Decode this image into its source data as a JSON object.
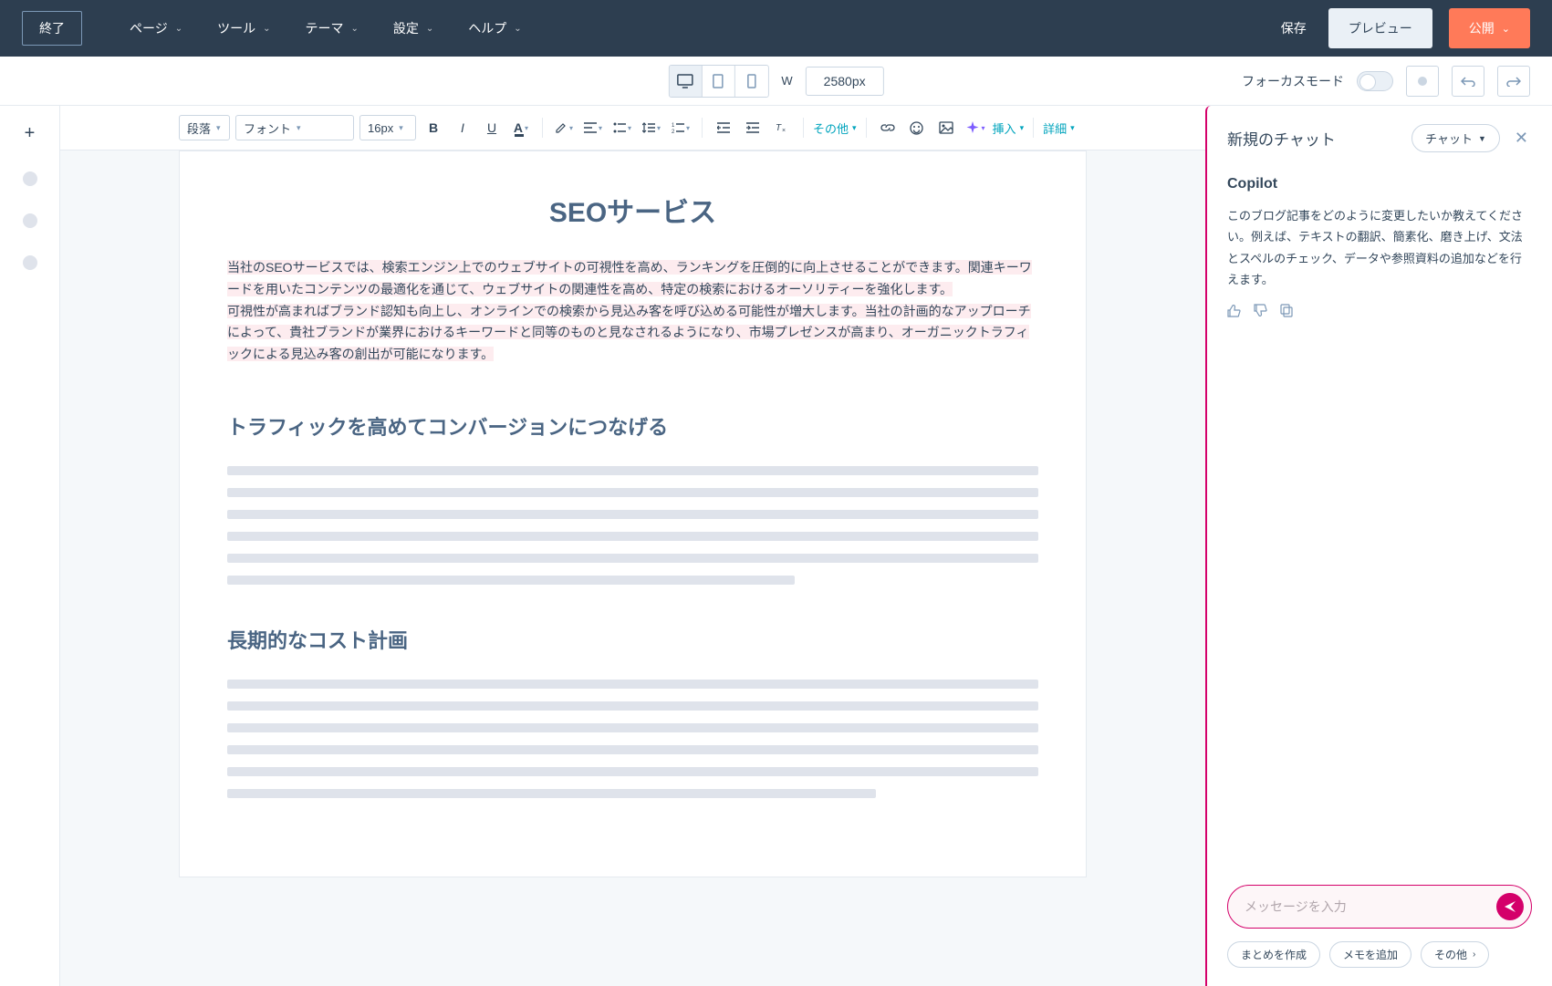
{
  "topbar": {
    "exit": "終了",
    "menus": [
      "ページ",
      "ツール",
      "テーマ",
      "設定",
      "ヘルプ"
    ],
    "save": "保存",
    "preview": "プレビュー",
    "publish": "公開"
  },
  "subbar": {
    "w_label": "W",
    "width_value": "2580px",
    "focus_mode": "フォーカスモード"
  },
  "toolbar": {
    "paragraph": "段落",
    "font": "フォント",
    "size": "16px",
    "more": "その他",
    "insert": "挿入",
    "details": "詳細"
  },
  "content": {
    "title": "SEOサービス",
    "intro_p1": "当社のSEOサービスでは、検索エンジン上でのウェブサイトの可視性を高め、ランキングを圧倒的に向上させることができます。関連キーワードを用いたコンテンツの最適化を通じて、ウェブサイトの関連性を高め、特定の検索におけるオーソリティーを強化します。",
    "intro_p2": "可視性が高まればブランド認知も向上し、オンラインでの検索から見込み客を呼び込める可能性が増大します。当社の計画的なアップローチによって、貴社ブランドが業界におけるキーワードと同等のものと見なされるようになり、市場プレゼンスが高まり、オーガニックトラフィックによる見込み客の創出が可能になります。",
    "h2_1": "トラフィックを高めてコンバージョンにつなげる",
    "h2_2": "長期的なコスト計画"
  },
  "chat": {
    "new_chat": "新規のチャット",
    "chat_menu": "チャット",
    "agent": "Copilot",
    "message": "このブログ記事をどのように変更したいか教えてください。例えば、テキストの翻訳、簡素化、磨き上げ、文法とスペルのチェック、データや参照資料の追加などを行えます。",
    "input_placeholder": "メッセージを入力",
    "act_summary": "まとめを作成",
    "act_memo": "メモを追加",
    "act_other": "その他"
  }
}
